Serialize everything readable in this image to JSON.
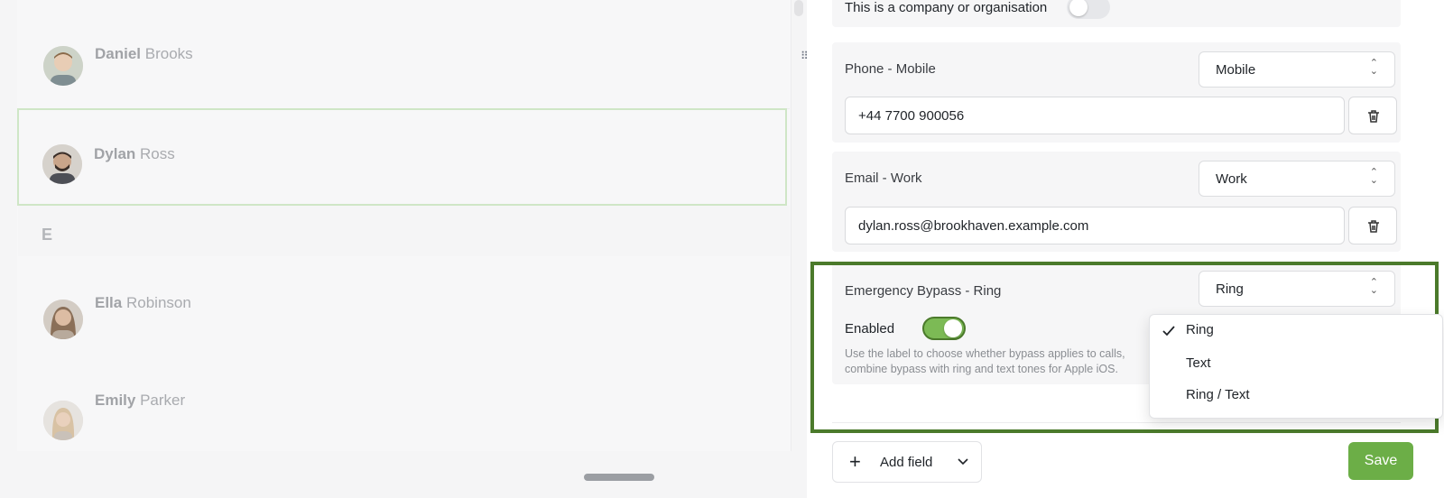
{
  "contacts": {
    "rows": [
      {
        "first": "Daniel",
        "last": "Brooks"
      },
      {
        "first": "Dylan",
        "last": "Ross",
        "selected": true
      },
      {
        "first": "Ella",
        "last": "Robinson"
      },
      {
        "first": "Emily",
        "last": "Parker"
      }
    ],
    "section_letter": "E"
  },
  "form": {
    "company_label": "This is a company or organisation",
    "company_toggle_on": false,
    "phone": {
      "label": "Phone - Mobile",
      "type": "Mobile",
      "value": "+44 7700 900056"
    },
    "email": {
      "label": "Email - Work",
      "type": "Work",
      "value": "dylan.ross@brookhaven.example.com"
    },
    "bypass": {
      "label": "Emergency Bypass - Ring",
      "type": "Ring",
      "enabled_label": "Enabled",
      "enabled": true,
      "help_line1": "Use the label to choose whether bypass applies to calls,",
      "help_line2": "combine bypass with ring and text tones for Apple iOS."
    },
    "dropdown": {
      "options": [
        "Ring",
        "Text",
        "Ring / Text"
      ],
      "selected": "Ring"
    },
    "add_field_label": "Add field",
    "save_label": "Save"
  },
  "colors": {
    "accent_green": "#6cae47",
    "highlight_border": "#4b7a2b",
    "toggle_on": "#7cba55"
  }
}
